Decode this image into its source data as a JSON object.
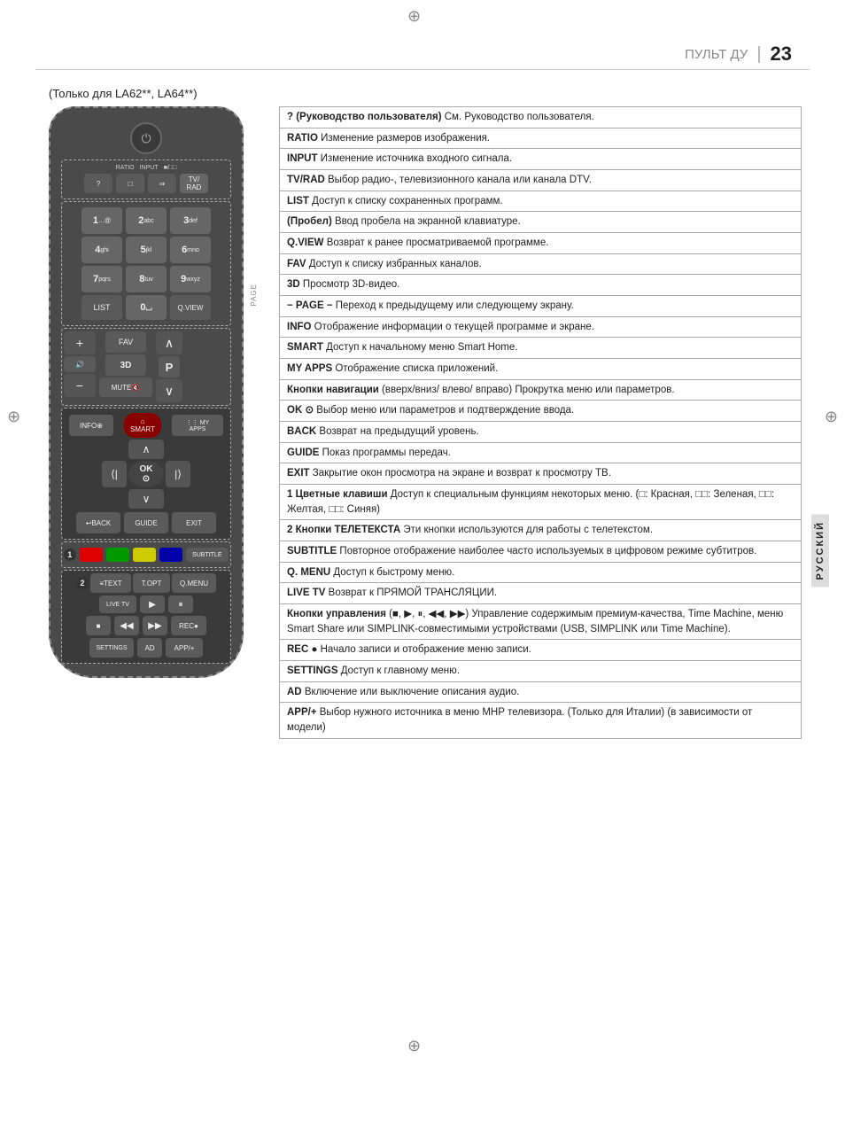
{
  "page": {
    "title": "ПУЛЬТ ДУ",
    "number": "23",
    "model_label": "(Только для LA62**, LA64**)"
  },
  "remote": {
    "buttons": {
      "power": "⏻",
      "ratio": "RATIO",
      "input": "INPUT",
      "tv_rad": "TV/RAD",
      "user_guide": "?",
      "space": "⌴",
      "input_src": "⇒",
      "tv_icon": "📺",
      "num1": "1",
      "num1_sub": "…@",
      "num2": "2",
      "num2_sub": "abc",
      "num3": "3",
      "num3_sub": "def",
      "num4": "4",
      "num4_sub": "ghi",
      "num5": "5",
      "num5_sub": "jkl",
      "num6": "6",
      "num6_sub": "mno",
      "num7": "7",
      "num7_sub": "pqrs",
      "num8": "8",
      "num8_sub": "tuv",
      "num9": "9",
      "num9_sub": "wxyz",
      "list": "LIST",
      "num0": "0",
      "qview": "Q.VIEW",
      "fav": "FAV",
      "three_d": "3D",
      "mute": "MUTE🔇",
      "p_label": "P",
      "vol_up": "+",
      "vol_dn": "−",
      "ch_up": "∧",
      "ch_dn": "∨",
      "info": "INFO ⊕",
      "smart": "⌂ SMART",
      "my_apps": "⋮⋮ MY APPS",
      "nav_up": "∧",
      "nav_left": "⟨|",
      "nav_ok": "OK ⊙",
      "nav_right": "|⟩",
      "nav_down": "∨",
      "back": "↩ BACK",
      "guide": "GUIDE",
      "exit": "EXIT",
      "color_red": "",
      "color_green": "",
      "color_yellow": "",
      "color_blue": "",
      "subtitle": "SUBTITLE",
      "text": "≡TEXT",
      "t_opt": "T.OPT",
      "q_menu": "Q.MENU",
      "live_tv": "LIVE TV",
      "play": "▶",
      "pause": "⏸",
      "stop": "■",
      "rew": "◀◀",
      "ff": "▶▶",
      "rec": "REC●",
      "settings": "SETTINGS",
      "ad": "AD",
      "app": "APP/+"
    }
  },
  "annotations": [
    {
      "key": "? (Руководство пользователя)",
      "text": "См. Руководство пользователя."
    },
    {
      "key": "RATIO",
      "text": "Изменение размеров изображения."
    },
    {
      "key": "INPUT",
      "text": "Изменение источника входного сигнала."
    },
    {
      "key": "TV/RAD",
      "text": "Выбор радио-, телевизионного канала или канала DTV."
    },
    {
      "key": "LIST",
      "text": "Доступ к списку сохраненных программ."
    },
    {
      "key": "(Пробел)",
      "text": "Ввод пробела на экранной клавиатуре."
    },
    {
      "key": "Q.VIEW",
      "text": "Возврат к ранее просматриваемой программе."
    },
    {
      "key": "FAV",
      "text": "Доступ к списку избранных каналов."
    },
    {
      "key": "3D",
      "text": "Просмотр 3D-видео."
    },
    {
      "key": "− PAGE −",
      "text": "Переход к предыдущему или следующему экрану."
    },
    {
      "key": "INFO",
      "text": "Отображение информации о текущей программе и экране."
    },
    {
      "key": "SMART",
      "text": "Доступ к начальному меню Smart Home."
    },
    {
      "key": "MY APPS",
      "text": "Отображение списка приложений."
    },
    {
      "key": "Кнопки навигации",
      "text": "(вверх/вниз/ влево/ вправо) Прокрутка меню или параметров."
    },
    {
      "key": "OK ⊙",
      "text": "Выбор меню или параметров и подтверждение ввода."
    },
    {
      "key": "BACK",
      "text": "Возврат на предыдущий уровень."
    },
    {
      "key": "GUIDE",
      "text": "Показ программы передач."
    },
    {
      "key": "EXIT",
      "text": "Закрытие окон просмотра на экране и возврат к просмотру ТВ."
    },
    {
      "key": "1 Цветные клавиши",
      "text": "Доступ к специальным функциям некоторых меню. (□: Красная, □□: Зеленая, □□: Желтая, □□: Синяя)"
    },
    {
      "key": "2 Кнопки ТЕЛЕТЕКСТА",
      "text": "Эти кнопки используются для работы с телетекстом."
    },
    {
      "key": "SUBTITLE",
      "text": "Повторное отображение наиболее часто используемых в цифровом режиме субтитров."
    },
    {
      "key": "Q. MENU",
      "text": "Доступ к быстрому меню."
    },
    {
      "key": "LIVE TV",
      "text": "Возврат к ПРЯМОЙ ТРАНСЛЯЦИИ."
    },
    {
      "key": "Кнопки управления",
      "text": "(■, ▶, ⏸, ◀◀, ▶▶) Управление содержимым премиум-качества, Time Machine, меню Smart Share или SIMPLINK-совместимыми устройствами (USB, SIMPLINK или Time Machine)."
    },
    {
      "key": "REC ●",
      "text": "Начало записи и отображение меню записи."
    },
    {
      "key": "SETTINGS",
      "text": "Доступ к главному меню."
    },
    {
      "key": "AD",
      "text": "Включение или выключение описания аудио."
    },
    {
      "key": "APP/+",
      "text": "Выбор нужного источника в меню МНР телевизора. (Только для Италии) (в зависимости от модели)"
    }
  ],
  "side_label": "РУССКИЙ"
}
